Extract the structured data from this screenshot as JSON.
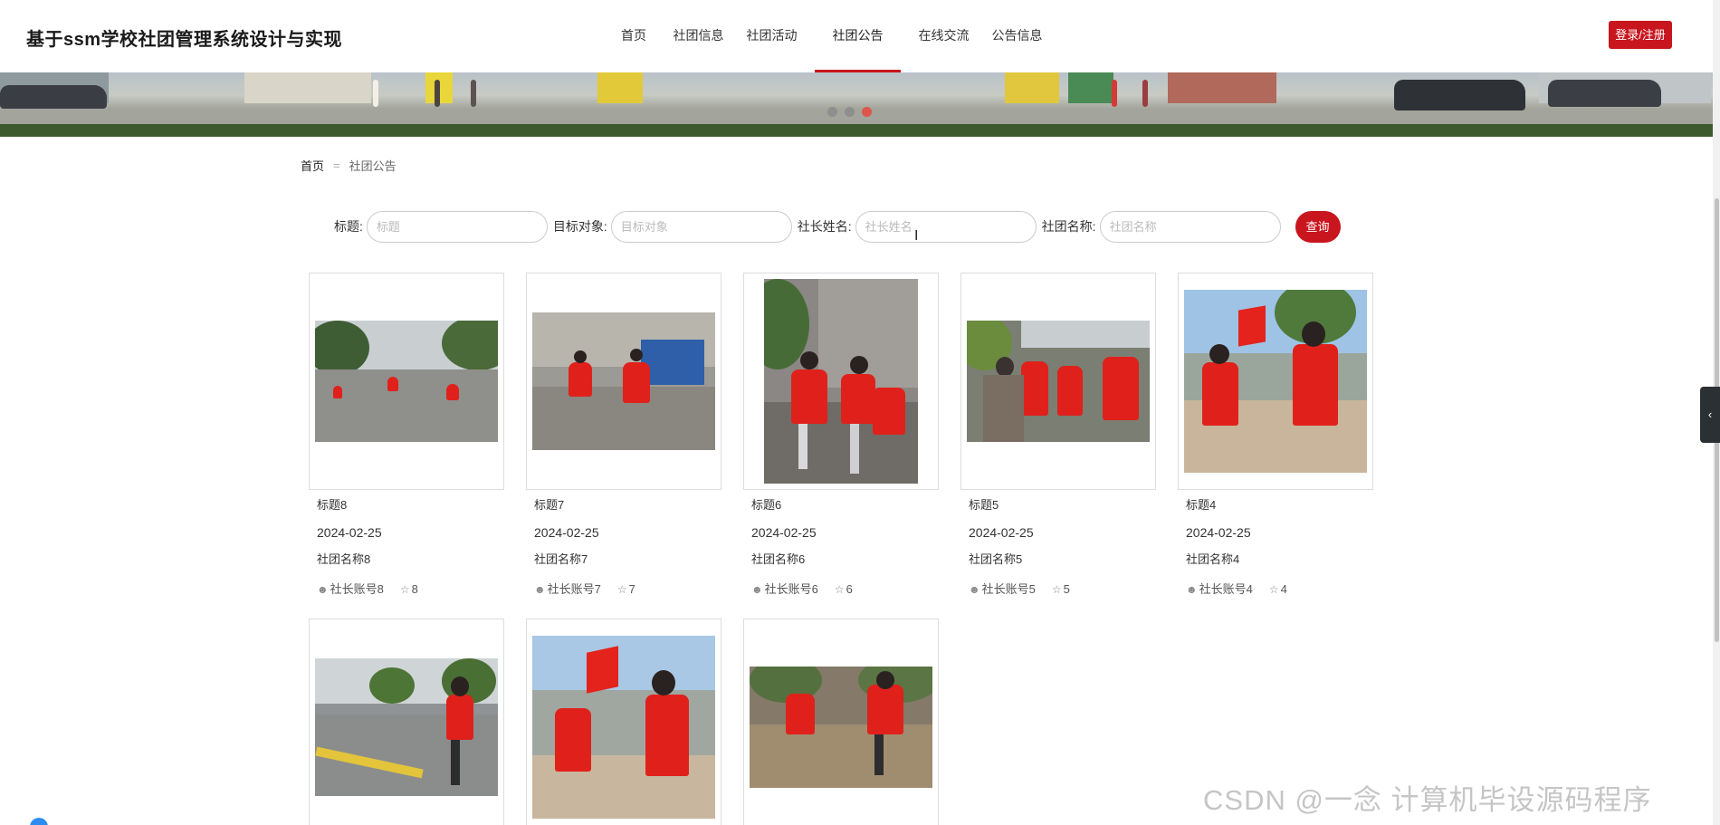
{
  "header": {
    "site_title": "基于ssm学校社团管理系统设计与实现",
    "nav": [
      {
        "label": "首页",
        "active": false
      },
      {
        "label": "社团信息",
        "active": false
      },
      {
        "label": "社团活动",
        "active": false
      },
      {
        "label": "社团公告",
        "active": true
      },
      {
        "label": "在线交流",
        "active": false
      },
      {
        "label": "公告信息",
        "active": false
      }
    ],
    "login_label": "登录/注册",
    "accent_color": "#c9151e"
  },
  "banner": {
    "slide_count": 3,
    "active_slide": 3
  },
  "breadcrumb": {
    "home": "首页",
    "separator": "=",
    "current": "社团公告"
  },
  "search": {
    "fields": [
      {
        "label": "标题:",
        "placeholder": "标题",
        "value": ""
      },
      {
        "label": "目标对象:",
        "placeholder": "目标对象",
        "value": ""
      },
      {
        "label": "社长姓名:",
        "placeholder": "社长姓名",
        "value": ""
      },
      {
        "label": "社团名称:",
        "placeholder": "社团名称",
        "value": ""
      }
    ],
    "button_label": "查询"
  },
  "cards": [
    {
      "title": "标题8",
      "date": "2024-02-25",
      "club": "社团名称8",
      "account": "社长账号8",
      "likes": "8"
    },
    {
      "title": "标题7",
      "date": "2024-02-25",
      "club": "社团名称7",
      "account": "社长账号7",
      "likes": "7"
    },
    {
      "title": "标题6",
      "date": "2024-02-25",
      "club": "社团名称6",
      "account": "社长账号6",
      "likes": "6"
    },
    {
      "title": "标题5",
      "date": "2024-02-25",
      "club": "社团名称5",
      "account": "社长账号5",
      "likes": "5"
    },
    {
      "title": "标题4",
      "date": "2024-02-25",
      "club": "社团名称4",
      "account": "社长账号4",
      "likes": "4"
    },
    {
      "title": "",
      "date": "",
      "club": "",
      "account": "",
      "likes": ""
    },
    {
      "title": "",
      "date": "",
      "club": "",
      "account": "",
      "likes": ""
    },
    {
      "title": "",
      "date": "",
      "club": "",
      "account": "",
      "likes": ""
    }
  ],
  "icons": {
    "user": "user-icon",
    "star": "star-icon",
    "side_tab": "chevron-left-icon"
  },
  "watermark": "CSDN @一念 计算机毕设源码程序"
}
